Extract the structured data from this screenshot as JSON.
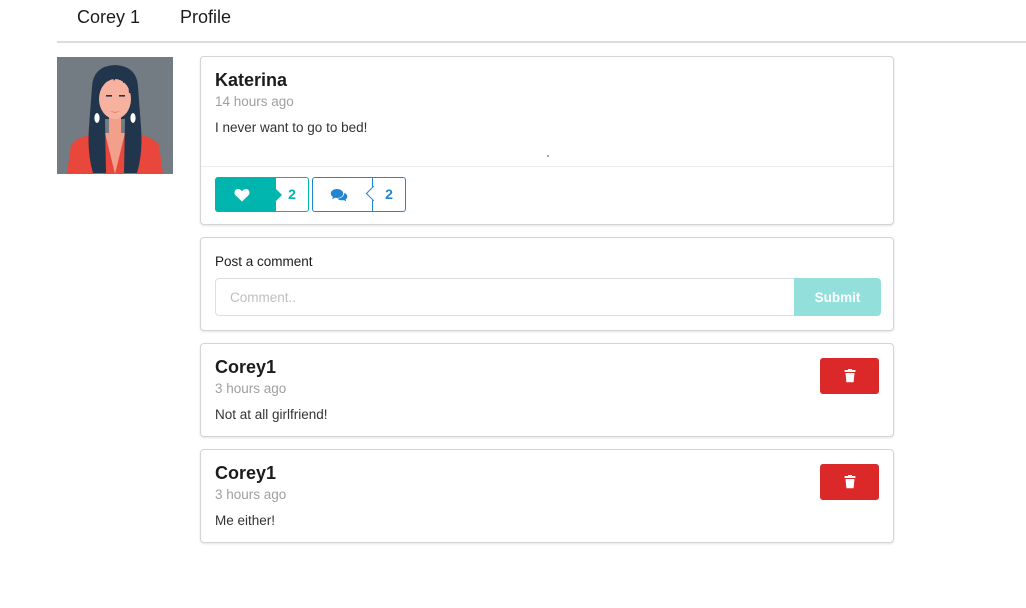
{
  "nav": {
    "items": [
      "Corey 1",
      "Profile"
    ]
  },
  "post": {
    "author": "Katerina",
    "time": "14 hours ago",
    "text": "I never want to go to bed!",
    "likes": "2",
    "comments": "2"
  },
  "comment_form": {
    "label": "Post a comment",
    "placeholder": "Comment..",
    "submit_label": "Submit"
  },
  "comments": [
    {
      "author": "Corey1",
      "time": "3 hours ago",
      "text": "Not at all girlfriend!"
    },
    {
      "author": "Corey1",
      "time": "3 hours ago",
      "text": "Me either!"
    }
  ],
  "icons": {
    "like": "heart-icon",
    "comment": "comments-icon",
    "delete": "trash-icon"
  },
  "colors": {
    "like": "#00b5ad",
    "comment": "#2185d0",
    "delete": "#db2828",
    "submit": "#93dfdc"
  }
}
